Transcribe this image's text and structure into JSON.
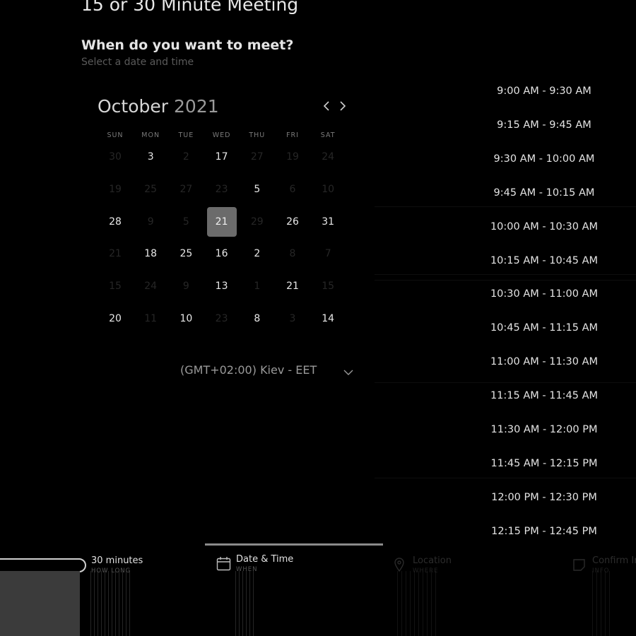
{
  "meeting": {
    "title": "15 or 30 Minute Meeting",
    "question": "When do you want to meet?",
    "subtitle": "Select a date and time"
  },
  "calendar": {
    "month": "October",
    "year": "2021",
    "weekdays": [
      "SUN",
      "MON",
      "TUE",
      "WED",
      "THU",
      "FRI",
      "SAT"
    ],
    "rows": [
      [
        {
          "d": "30",
          "on": false
        },
        {
          "d": "3",
          "on": true
        },
        {
          "d": "2",
          "on": false
        },
        {
          "d": "17",
          "on": true
        },
        {
          "d": "27",
          "on": false
        },
        {
          "d": "19",
          "on": false
        },
        {
          "d": "24",
          "on": false
        }
      ],
      [
        {
          "d": "19",
          "on": false
        },
        {
          "d": "25",
          "on": false
        },
        {
          "d": "27",
          "on": false
        },
        {
          "d": "23",
          "on": false
        },
        {
          "d": "5",
          "on": true
        },
        {
          "d": "6",
          "on": false
        },
        {
          "d": "10",
          "on": false
        }
      ],
      [
        {
          "d": "28",
          "on": true
        },
        {
          "d": "9",
          "on": false
        },
        {
          "d": "5",
          "on": false
        },
        {
          "d": "21",
          "on": true,
          "selected": true
        },
        {
          "d": "29",
          "on": false
        },
        {
          "d": "26",
          "on": true
        },
        {
          "d": "31",
          "on": true
        }
      ],
      [
        {
          "d": "21",
          "on": false
        },
        {
          "d": "18",
          "on": true
        },
        {
          "d": "25",
          "on": true
        },
        {
          "d": "16",
          "on": true
        },
        {
          "d": "2",
          "on": true
        },
        {
          "d": "8",
          "on": false
        },
        {
          "d": "7",
          "on": false
        }
      ],
      [
        {
          "d": "15",
          "on": false
        },
        {
          "d": "24",
          "on": false
        },
        {
          "d": "9",
          "on": false
        },
        {
          "d": "13",
          "on": true
        },
        {
          "d": "1",
          "on": false
        },
        {
          "d": "21",
          "on": true
        },
        {
          "d": "15",
          "on": false
        }
      ],
      [
        {
          "d": "20",
          "on": true
        },
        {
          "d": "11",
          "on": false
        },
        {
          "d": "10",
          "on": true
        },
        {
          "d": "23",
          "on": false
        },
        {
          "d": "8",
          "on": true
        },
        {
          "d": "3",
          "on": false
        },
        {
          "d": "14",
          "on": true
        }
      ]
    ]
  },
  "timezone": "(GMT+02:00) Kiev - EET",
  "slots": [
    "9:00 AM - 9:30 AM",
    "9:15 AM - 9:45 AM",
    "9:30 AM - 10:00 AM",
    "9:45 AM - 10:15 AM",
    "10:00 AM - 10:30 AM",
    "10:15 AM - 10:45 AM",
    "10:30 AM - 11:00 AM",
    "10:45 AM - 11:15 AM",
    "11:00 AM - 11:30 AM",
    "11:15 AM - 11:45 AM",
    "11:30 AM - 12:00 PM",
    "11:45 AM - 12:15 PM",
    "12:00 PM - 12:30 PM",
    "12:15 PM - 12:45 PM"
  ],
  "steps": [
    {
      "label": "30 minutes",
      "sub": "HOW LONG",
      "active": false
    },
    {
      "label": "Date & Time",
      "sub": "WHEN",
      "active": true,
      "icon": "calendar-icon"
    },
    {
      "label": "Location",
      "sub": "WHERE",
      "active": false,
      "icon": "map-pin-icon"
    },
    {
      "label": "Confirm In",
      "sub": "INFO",
      "active": false,
      "icon": "note-icon"
    }
  ]
}
